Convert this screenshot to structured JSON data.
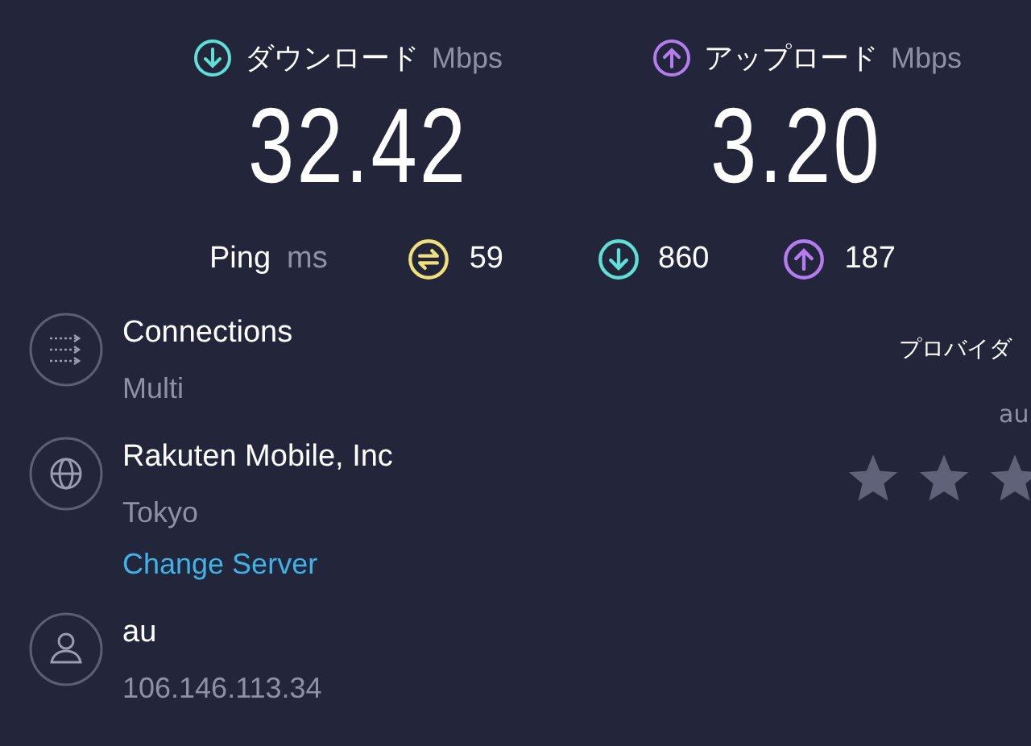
{
  "download": {
    "label": "ダウンロード",
    "unit": "Mbps",
    "value": "32.42"
  },
  "upload": {
    "label": "アップロード",
    "unit": "Mbps",
    "value": "3.20"
  },
  "ping": {
    "label": "Ping",
    "unit": "ms",
    "idle": "59",
    "download": "860",
    "upload": "187"
  },
  "details": [
    {
      "kind": "connections",
      "title": "Connections",
      "subtitle": "Multi"
    },
    {
      "kind": "server",
      "title": "Rakuten Mobile, Inc",
      "subtitle": "Tokyo",
      "link": "Change Server"
    },
    {
      "kind": "provider",
      "title": "au",
      "subtitle": "106.146.113.34"
    }
  ],
  "rating": {
    "prompt": "プロバイダ",
    "provider": "au"
  }
}
